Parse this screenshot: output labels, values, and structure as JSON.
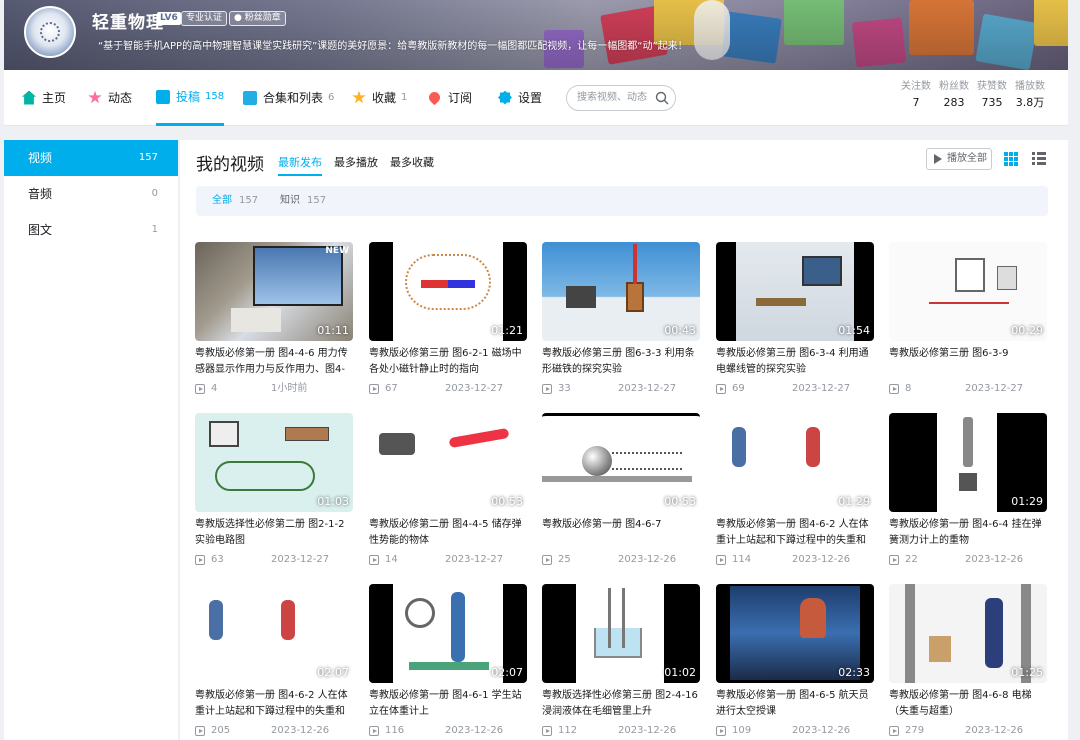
{
  "profile": {
    "name": "轻重物理",
    "level": "LV6",
    "tag1": "专业认证",
    "tag2": "粉丝勋章",
    "sign": "“基于智能手机APP的高中物理智慧课堂实践研究”课题的美好愿景：给粤教版新教材的每一幅图都匹配视频，让每一幅图都“动”起来！"
  },
  "nav": [
    {
      "label": "主页",
      "count": "",
      "icon": "home-icon",
      "color": "#00b5a5"
    },
    {
      "label": "动态",
      "count": "",
      "icon": "dynamic-icon",
      "color": "#fb7299"
    },
    {
      "label": "投稿",
      "count": "158",
      "icon": "upload-icon",
      "color": "#00aeec"
    },
    {
      "label": "合集和列表",
      "count": "6",
      "icon": "collection-icon",
      "color": "#23ade5"
    },
    {
      "label": "收藏",
      "count": "1",
      "icon": "star-icon",
      "color": "#ffb027"
    },
    {
      "label": "订阅",
      "count": "",
      "icon": "heart-icon",
      "color": "#f85a54"
    },
    {
      "label": "设置",
      "count": "",
      "icon": "gear-icon",
      "color": "#00aeec"
    }
  ],
  "search": {
    "placeholder": "搜索视频、动态"
  },
  "stats": [
    {
      "k": "关注数",
      "v": "7"
    },
    {
      "k": "粉丝数",
      "v": "283"
    },
    {
      "k": "获赞数",
      "v": "735"
    },
    {
      "k": "播放数",
      "v": "3.8万"
    }
  ],
  "sidebar": [
    {
      "label": "视频",
      "count": "157"
    },
    {
      "label": "音频",
      "count": "0"
    },
    {
      "label": "图文",
      "count": "1"
    }
  ],
  "main": {
    "title": "我的视频",
    "sorts": [
      "最新发布",
      "最多播放",
      "最多收藏"
    ],
    "play_all": "播放全部"
  },
  "filters": [
    {
      "label": "全部",
      "count": "157"
    },
    {
      "label": "知识",
      "count": "157"
    }
  ],
  "videos": [
    {
      "title": "粤教版必修第一册 图4-4-6 用力传感器显示作用力与反作用力、图4-",
      "duration": "01:11",
      "plays": "4",
      "date": "1小时前",
      "new": "NEW"
    },
    {
      "title": "粤教版必修第三册 图6-2-1 磁场中各处小磁针静止时的指向",
      "duration": "01:21",
      "plays": "67",
      "date": "2023-12-27"
    },
    {
      "title": "粤教版必修第三册 图6-3-3 利用条形磁铁的探究实验",
      "duration": "00:43",
      "plays": "33",
      "date": "2023-12-27"
    },
    {
      "title": "粤教版必修第三册 图6-3-4 利用通电螺线管的探究实验",
      "duration": "01:54",
      "plays": "69",
      "date": "2023-12-27"
    },
    {
      "title": "粤教版必修第三册 图6-3-9",
      "duration": "00:29",
      "plays": "8",
      "date": "2023-12-27"
    },
    {
      "title": "粤教版选择性必修第二册 图2-1-2 实验电路图",
      "duration": "01:03",
      "plays": "63",
      "date": "2023-12-27"
    },
    {
      "title": "粤教版必修第二册 图4-4-5 储存弹性势能的物体",
      "duration": "00:53",
      "plays": "14",
      "date": "2023-12-27"
    },
    {
      "title": "粤教版必修第一册 图4-6-7",
      "duration": "00:53",
      "plays": "25",
      "date": "2023-12-26"
    },
    {
      "title": "粤教版必修第一册 图4-6-2 人在体重计上站起和下蹲过程中的失重和",
      "duration": "01:29",
      "plays": "114",
      "date": "2023-12-26"
    },
    {
      "title": "粤教版必修第一册 图4-6-4 挂在弹簧测力计上的重物",
      "duration": "01:29",
      "plays": "22",
      "date": "2023-12-26"
    },
    {
      "title": "粤教版必修第一册 图4-6-2 人在体重计上站起和下蹲过程中的失重和",
      "duration": "02:07",
      "plays": "205",
      "date": "2023-12-26"
    },
    {
      "title": "粤教版必修第一册 图4-6-1 学生站立在体重计上",
      "duration": "02:07",
      "plays": "116",
      "date": "2023-12-26"
    },
    {
      "title": "粤教版选择性必修第三册 图2-4-16 浸润液体在毛细管里上升",
      "duration": "01:02",
      "plays": "112",
      "date": "2023-12-26"
    },
    {
      "title": "粤教版必修第一册 图4-6-5 航天员进行太空授课",
      "duration": "02:33",
      "plays": "109",
      "date": "2023-12-26"
    },
    {
      "title": "粤教版必修第一册 图4-6-8 电梯（失重与超重）",
      "duration": "01:25",
      "plays": "279",
      "date": "2023-12-26"
    }
  ],
  "colors": {
    "accent": "#00aeec"
  }
}
